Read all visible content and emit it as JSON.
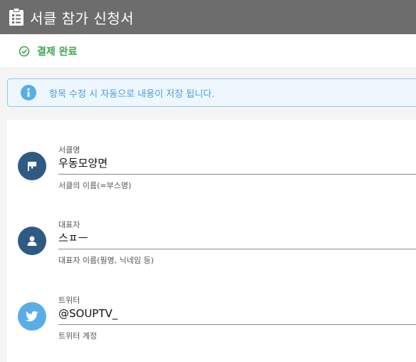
{
  "header": {
    "title": "서클 참가 신청서",
    "icon": "clipboard-icon"
  },
  "status": {
    "label": "결제 완료",
    "icon": "check-circle-icon",
    "color": "#3aa54b"
  },
  "info": {
    "text": "항목 수정 시 자동으로 내용이 저장 됩니다.",
    "icon": "info-icon"
  },
  "fields": [
    {
      "label": "서클명",
      "value": "우동모양면",
      "hint": "서클의 이름(=부스명)",
      "icon": "flag-icon",
      "icon_color": "#2f5a84"
    },
    {
      "label": "대표자",
      "value": "스ㅍㅡ",
      "hint": "대표자 이름(필명, 닉네임 등)",
      "icon": "person-icon",
      "icon_color": "#2f5a84"
    },
    {
      "label": "트위터",
      "value": "@SOUPTV_",
      "hint": "트위터 계정",
      "icon": "twitter-icon",
      "icon_color": "#5aaee8"
    }
  ]
}
